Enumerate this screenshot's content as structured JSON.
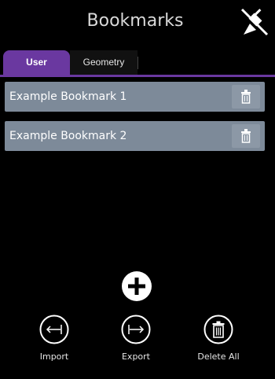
{
  "header": {
    "title": "Bookmarks",
    "pin_icon": "unpin-icon"
  },
  "tabs": [
    {
      "label": "User",
      "active": true
    },
    {
      "label": "Geometry",
      "active": false
    }
  ],
  "bookmarks": [
    {
      "label": "Example Bookmark 1"
    },
    {
      "label": "Example Bookmark 2"
    }
  ],
  "actions": {
    "add_icon": "plus-circle-icon",
    "import_label": "Import",
    "export_label": "Export",
    "delete_all_label": "Delete All"
  },
  "colors": {
    "accent": "#6a38a0",
    "bookmark_bg": "#7d8a99",
    "background": "#000000"
  }
}
